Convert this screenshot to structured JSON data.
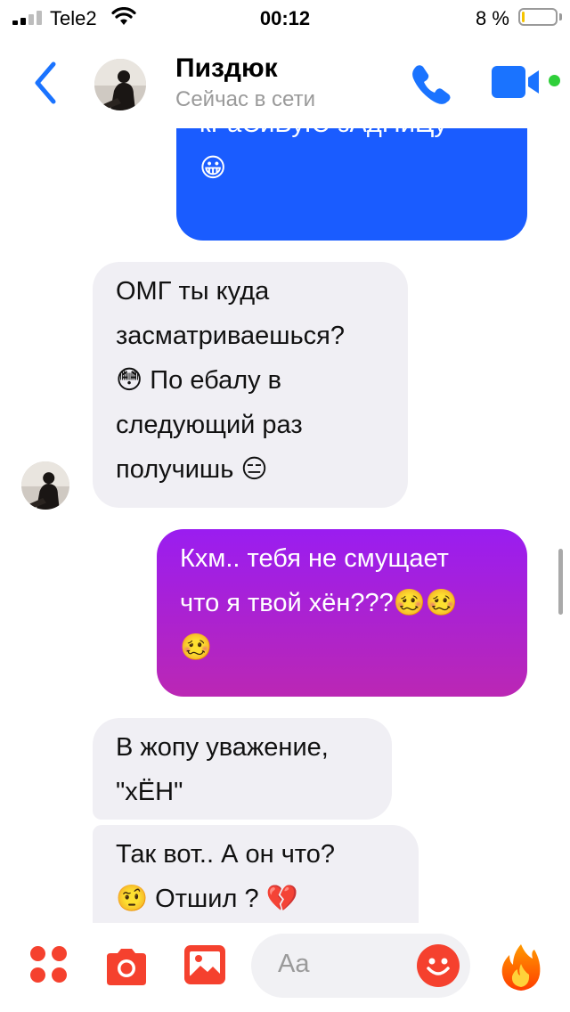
{
  "status_bar": {
    "carrier": "Tele2",
    "time": "00:12",
    "battery_percent": "8 %",
    "battery_level": 0.08
  },
  "header": {
    "contact_name": "Пиздюк",
    "contact_status": "Сейчас в сети",
    "icons": [
      "back-chevron-icon",
      "phone-icon",
      "video-camera-icon",
      "online-dot"
    ],
    "accent_color": "#1a73ff"
  },
  "messages": [
    {
      "direction": "outgoing",
      "lines": [
        "кРаСиВуЮ зАдНиЦу",
        "😀"
      ],
      "color": "#1a5cff"
    },
    {
      "direction": "incoming",
      "lines": [
        "ОМГ ты куда",
        "засматриваешься?",
        "😳 По ебалу в",
        "следующий раз",
        "получишь 😑"
      ]
    },
    {
      "direction": "outgoing",
      "lines": [
        "Кхм.. тебя не смущает",
        "что я твой хён???🥴🥴",
        "🥴"
      ],
      "color_top": "#9a1df0",
      "color_bottom": "#bb27b4"
    },
    {
      "direction": "incoming",
      "lines": [
        "В жопу уважение,",
        "\"хЁН\""
      ]
    },
    {
      "direction": "incoming",
      "lines": [
        "Так вот.. А он что?",
        "🤨 Отшил ? 💔"
      ]
    }
  ],
  "composer": {
    "placeholder": "Aa",
    "icons": [
      "menu-dots-icon",
      "camera-icon",
      "gallery-icon",
      "emoji-icon",
      "fire-reaction-icon"
    ],
    "accent_color": "#f5412e"
  }
}
